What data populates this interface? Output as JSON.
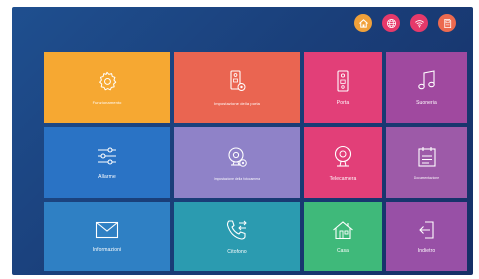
{
  "topbar": {
    "icons": [
      {
        "name": "home-icon",
        "color": "#f0a13a"
      },
      {
        "name": "globe-icon",
        "color": "#e6396a"
      },
      {
        "name": "wifi-icon",
        "color": "#e6396a"
      },
      {
        "name": "sd-card-icon",
        "color": "#ec6a4f"
      }
    ]
  },
  "tiles": [
    {
      "label": "Funzionamento",
      "color": "#f6a832"
    },
    {
      "label": "Impostazione della porta",
      "color": "#ea6551"
    },
    {
      "label": "Porta",
      "color": "#e23f78"
    },
    {
      "label": "Suoneria",
      "color": "#a0499f"
    },
    {
      "label": "Allarme",
      "color": "#2a73c5"
    },
    {
      "label": "Impostazione della fotocamera",
      "color": "#8f82c8"
    },
    {
      "label": "Telecamera",
      "color": "#e23f78"
    },
    {
      "label": "Documentazione",
      "color": "#9d5aa8"
    },
    {
      "label": "Informazioni",
      "color": "#2f80c4"
    },
    {
      "label": "Citofono",
      "color": "#2b9bb0"
    },
    {
      "label": "Casa",
      "color": "#3fb97a"
    },
    {
      "label": "Indietro",
      "color": "#9850a6"
    }
  ]
}
